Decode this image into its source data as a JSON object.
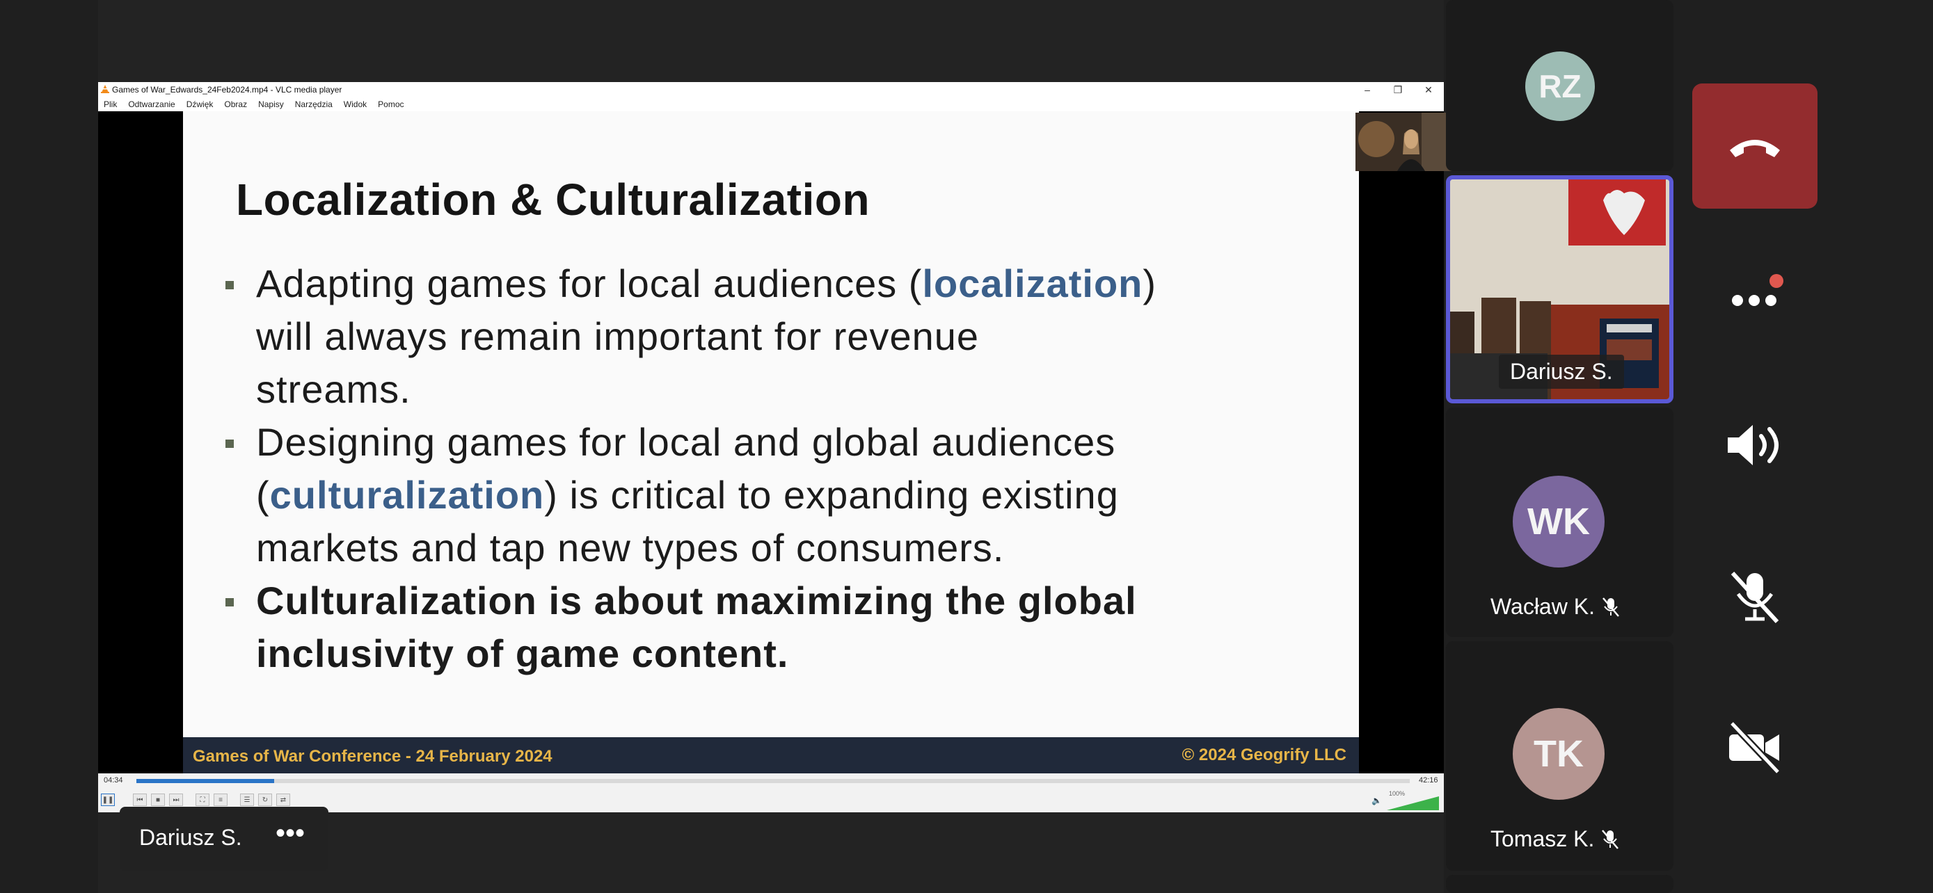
{
  "vlc": {
    "title": "Games of War_Edwards_24Feb2024.mp4 - VLC media player",
    "menu": [
      "Plik",
      "Odtwarzanie",
      "Dźwięk",
      "Obraz",
      "Napisy",
      "Narzędzia",
      "Widok",
      "Pomoc"
    ],
    "elapsed": "04:34",
    "duration": "42:16",
    "progress_fraction": 0.108,
    "volume": "100%"
  },
  "slide": {
    "title": "Localization & Culturalization",
    "b1_a": "Adapting games for local audiences (",
    "b1_hl": "localization",
    "b1_b": ")",
    "b1_line2": "will always remain important for revenue",
    "b1_line3": "streams.",
    "b2_line1": "Designing games for local and global audiences",
    "b2_a": "(",
    "b2_hl": "culturalization",
    "b2_b": ") is critical to expanding existing",
    "b2_line3": "markets and tap new types of consumers.",
    "b3_line1": "Culturalization is about maximizing the global",
    "b3_line2": "inclusivity of game content.",
    "footer_left": "Games of War Conference - 24 February 2024",
    "footer_right": "© 2024 Geogrify LLC"
  },
  "name_chip": {
    "name": "Dariusz S.",
    "more": "•••"
  },
  "participants": [
    {
      "initials": "RZ",
      "name": "",
      "avatar_color": "#9dbcb4"
    },
    {
      "initials": "",
      "name": "Dariusz S.",
      "active_speaker": true
    },
    {
      "initials": "WK",
      "name": "Wacław K.",
      "avatar_color": "#7b679e",
      "muted": true
    },
    {
      "initials": "TK",
      "name": "Tomasz K.",
      "avatar_color": "#b59591",
      "muted": true
    }
  ],
  "controls": {
    "leave_color": "#932c2e",
    "more_badge_color": "#e0584f"
  }
}
